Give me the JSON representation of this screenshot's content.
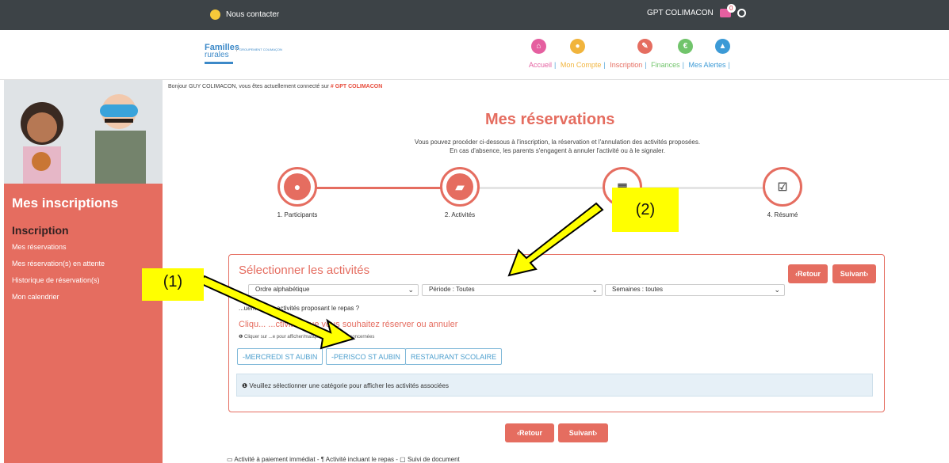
{
  "topbar": {
    "contact": "Nous contacter",
    "account": "GPT COLIMACON",
    "mail_count": "0"
  },
  "header": {
    "logo": {
      "line1": "Familles",
      "line2": "rurales",
      "group": "GROUPEMENT COLIMAÇON"
    },
    "nav": [
      {
        "label": "Accueil",
        "color": "#e55fa0"
      },
      {
        "label": "Mon Compte",
        "color": "#f1b43c"
      },
      {
        "label": "Inscription",
        "color": "#e56d60"
      },
      {
        "label": "Finances",
        "color": "#71c46b"
      },
      {
        "label": "Mes Alertes",
        "color": "#3c9ad6"
      }
    ]
  },
  "sidebar": {
    "title": "Mes inscriptions",
    "section": "Inscription",
    "items": [
      "Mes réservations",
      "Mes réservation(s) en attente",
      "Historique de réservation(s)",
      "Mon calendrier"
    ]
  },
  "welcome": {
    "text": "Bonjour GUY COLIMACON, vous êtes actuellement connecté sur ",
    "org": "# GPT COLIMACON"
  },
  "main": {
    "title": "Mes réservations",
    "intro1": "Vous pouvez procéder ci-dessous à l'inscription, la réservation et l'annulation des activités proposées.",
    "intro2": "En cas d'absence, les parents s'engagent à annuler l'activité ou à le signaler.",
    "steps": [
      {
        "label": "1. Participants",
        "icon": "users-icon"
      },
      {
        "label": "2. Activités",
        "icon": "book-icon"
      },
      {
        "label": "3. ...",
        "icon": "calendar-icon"
      },
      {
        "label": "4. Résumé",
        "icon": "check-icon"
      }
    ],
    "panel": {
      "title": "Sélectionner les activités",
      "back": "‹Retour",
      "next": "Suivant›",
      "order": "Ordre alphabétique",
      "period": "Période : Toutes",
      "weeks": "Semaines : toutes",
      "meal": "...uement les activités proposant le repas ?",
      "click": "Cliqu... ...ctivités que vous souhaitez réserver ou annuler",
      "hint": "❶ Cliquer sur ...e pour afficher/masquer les activités concernées",
      "categories": [
        "-MERCREDI ST AUBIN",
        "-PERISCO ST AUBIN",
        "RESTAURANT SCOLAIRE"
      ],
      "notice": "❶ Veuillez sélectionner une catégorie pour afficher les activités associées"
    },
    "back": "‹Retour",
    "next": "Suivant›",
    "footer": "▭ Activité à paiement immédiat - ¶ Activité incluant le repas - ▢ Suivi de document"
  },
  "callouts": {
    "one": "(1)",
    "two": "(2)"
  },
  "colors": {
    "accent": "#e56d60",
    "topbar": "#3d4347",
    "callout": "#ffff00"
  }
}
